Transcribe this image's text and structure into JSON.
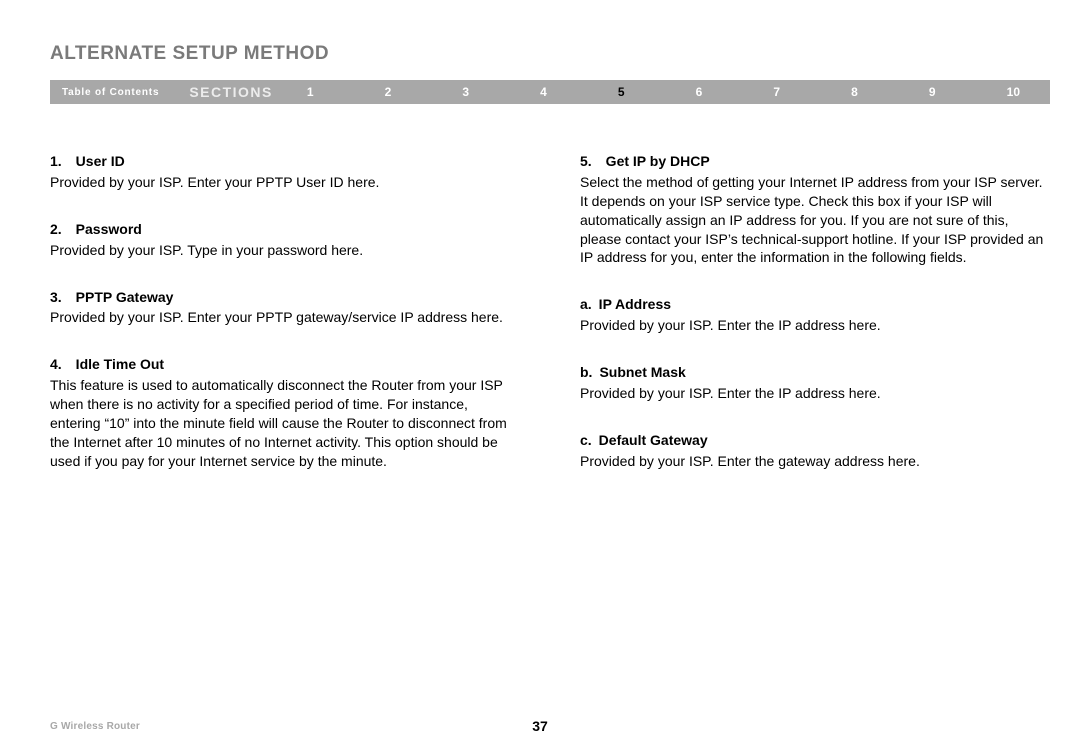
{
  "title": "ALTERNATE SETUP METHOD",
  "nav": {
    "toc": "Table of Contents",
    "sections_label": "SECTIONS",
    "items": [
      "1",
      "2",
      "3",
      "4",
      "5",
      "6",
      "7",
      "8",
      "9",
      "10"
    ],
    "active": "5"
  },
  "left": {
    "h1": "1. User ID",
    "p1": "Provided by your ISP. Enter your PPTP User ID here.",
    "h2": "2. Password",
    "p2": "Provided by your ISP. Type in your password here.",
    "h3": "3. PPTP Gateway",
    "p3": "Provided by your ISP. Enter your PPTP gateway/service IP address here.",
    "h4": "4. Idle Time Out",
    "p4": "This feature is used to automatically disconnect the Router from your ISP when there is no activity for a specified period of time. For instance, entering “10” into the minute field will cause the Router to disconnect from the Internet after 10 minutes of no Internet activity. This option should be used if you pay for your Internet service by the minute."
  },
  "right": {
    "h1": "5. Get IP by DHCP",
    "p1": "Select the method of getting your Internet IP address from your ISP server. It depends on your ISP service type. Check this box if your ISP will automatically assign an IP address for you. If you are not sure of this, please contact your ISP’s technical-support hotline. If your ISP provided an IP address for you, enter the information in the following fields.",
    "h2": "a. IP Address",
    "p2": "Provided by your ISP. Enter the IP address here.",
    "h3": "b. Subnet Mask",
    "p3": "Provided by your ISP. Enter the IP address here.",
    "h4": "c. Default Gateway",
    "p4": "Provided by your ISP. Enter the gateway address here."
  },
  "footer": {
    "product": "G Wireless Router",
    "page": "37"
  }
}
